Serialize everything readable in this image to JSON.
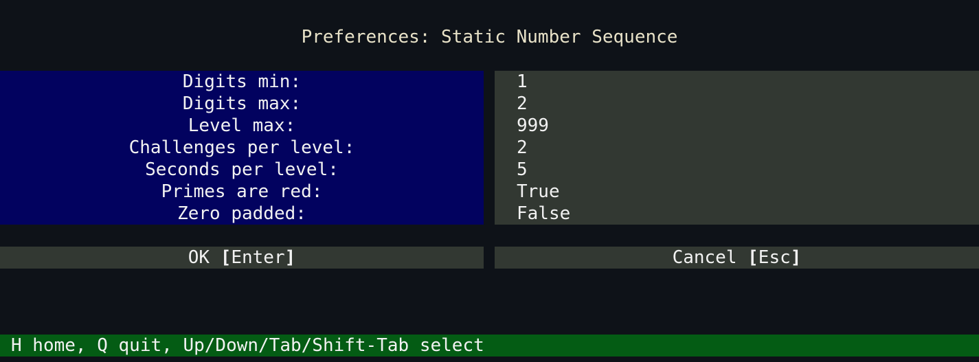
{
  "title": "Preferences: Static Number Sequence",
  "settings": [
    {
      "label": "Digits min:",
      "value": "1"
    },
    {
      "label": "Digits max:",
      "value": "2"
    },
    {
      "label": "Level max:",
      "value": "999"
    },
    {
      "label": "Challenges per level:",
      "value": "2"
    },
    {
      "label": "Seconds per level:",
      "value": "5"
    },
    {
      "label": "Primes are red:",
      "value": "True"
    },
    {
      "label": "Zero padded:",
      "value": "False"
    }
  ],
  "buttons": {
    "ok": {
      "label": "OK",
      "key": "Enter"
    },
    "cancel": {
      "label": "Cancel",
      "key": "Esc"
    }
  },
  "status_bar": {
    "text": "H home, Q quit, Up/Down/Tab/Shift-Tab select"
  },
  "colors": {
    "background": "#0e1218",
    "labels_panel": "#02025f",
    "values_panel": "#323832",
    "status_bar": "#045c14",
    "title_text": "#e8e2c8"
  }
}
